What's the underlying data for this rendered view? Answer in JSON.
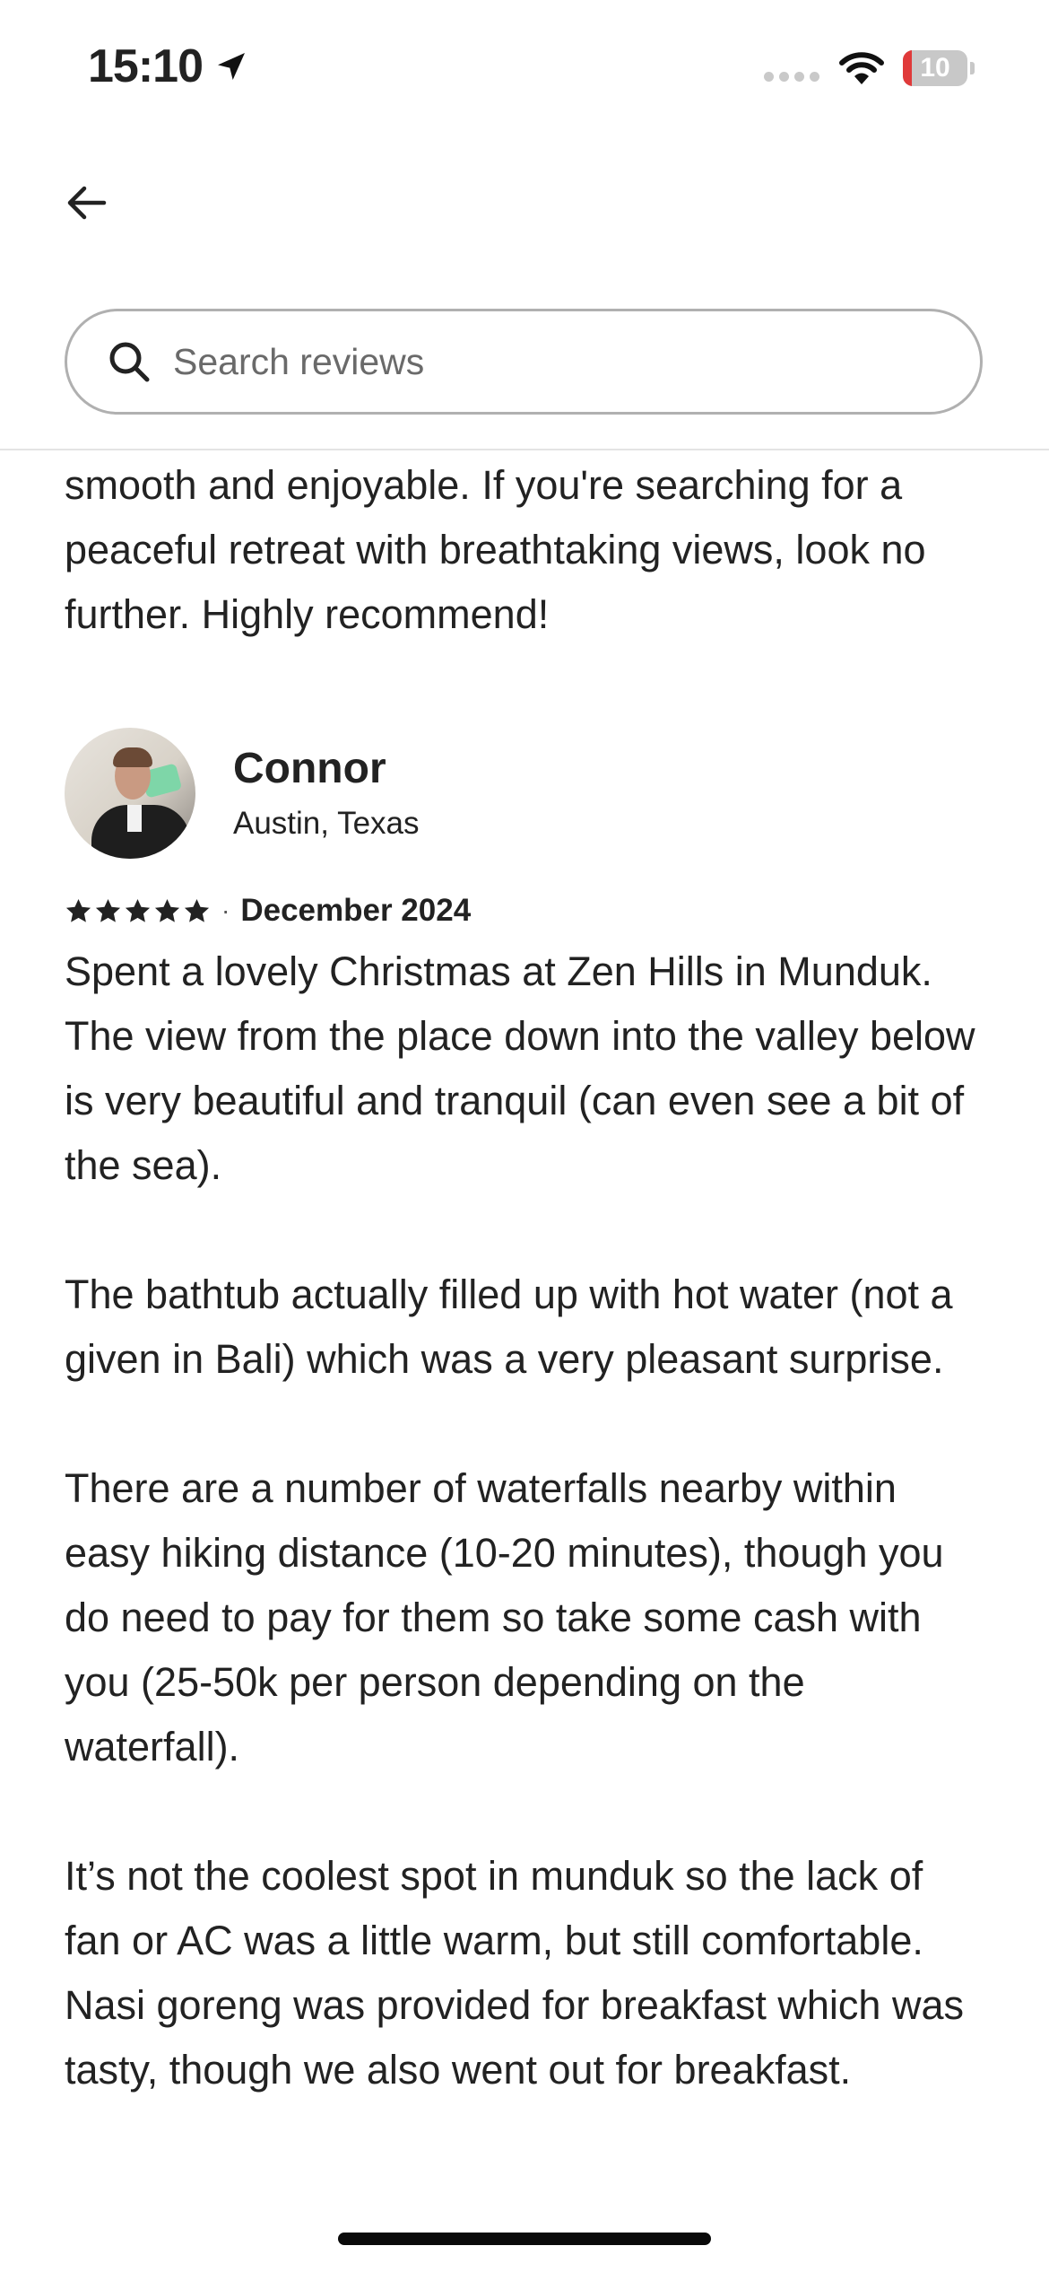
{
  "status_bar": {
    "time": "15:10",
    "battery_level": "10",
    "battery_fraction": 0.1,
    "battery_low_color": "#e03a3a"
  },
  "header": {
    "back_icon": "arrow-left-icon"
  },
  "search": {
    "placeholder": "Search reviews",
    "icon": "search-icon"
  },
  "previous_review": {
    "text_tail": "smooth and enjoyable. If you're searching for a peaceful retreat with breathtaking views, look no further. Highly recommend!"
  },
  "review": {
    "reviewer_name": "Connor",
    "reviewer_location": "Austin, Texas",
    "rating": 5,
    "rating_max": 5,
    "separator": "·",
    "date": "December 2024",
    "body": "Spent a lovely Christmas at Zen Hills in Munduk. The view from the place down into the valley below is very beautiful and tranquil (can even see a bit of the sea).\n\nThe bathtub actually filled up with hot water (not a given in Bali) which was a very pleasant surprise.\n\nThere are a number of waterfalls nearby within easy hiking distance (10-20 minutes), though you do need to pay for them so take some cash with you (25-50k per person depending on the waterfall).\n\nIt’s not the coolest spot in munduk so the lack of fan or AC was a little warm, but still comfortable. Nasi goreng was provided for breakfast which was tasty, though we also went out for breakfast."
  }
}
